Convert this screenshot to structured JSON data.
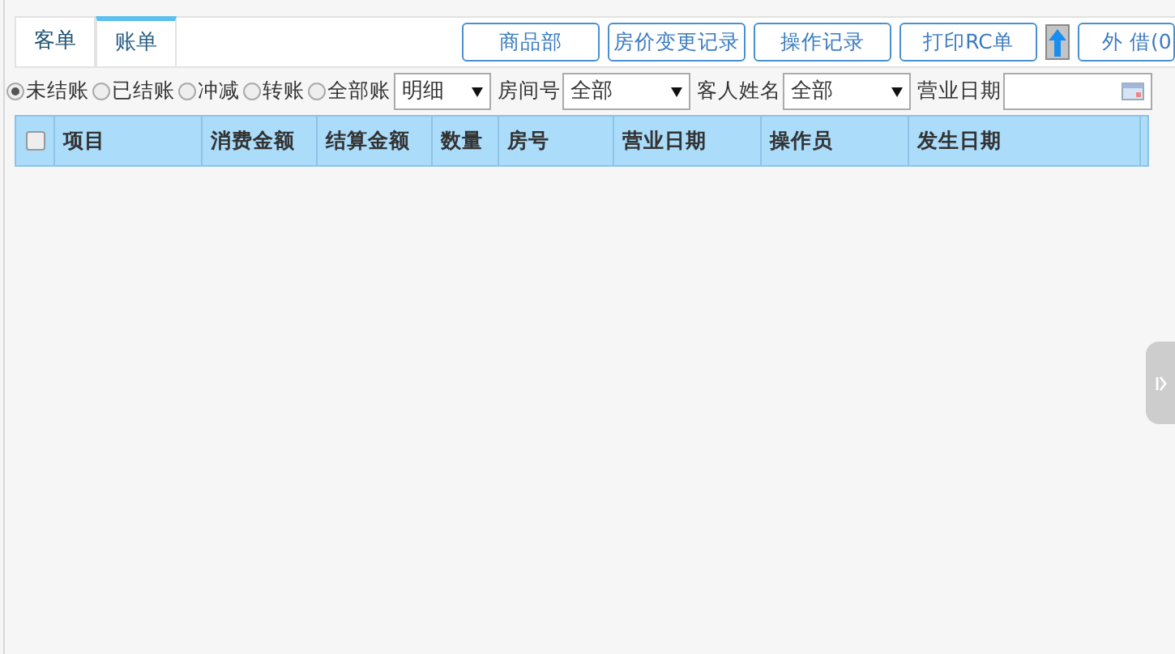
{
  "tabs": [
    {
      "label": "客单",
      "selected": false
    },
    {
      "label": "账单",
      "selected": true
    }
  ],
  "toolbar": [
    {
      "kind": "text",
      "label": "商品部"
    },
    {
      "kind": "text",
      "label": "房价变更记录"
    },
    {
      "kind": "text",
      "label": "操作记录"
    },
    {
      "kind": "text",
      "label": "打印RC单"
    },
    {
      "kind": "arrow"
    },
    {
      "kind": "text",
      "label": "外 借(0"
    }
  ],
  "status_filter": [
    {
      "label": "未结账",
      "selected": true
    },
    {
      "label": "已结账",
      "selected": false
    },
    {
      "label": "冲减",
      "selected": false
    },
    {
      "label": "转账",
      "selected": false
    },
    {
      "label": "全部账",
      "selected": false
    }
  ],
  "view_select": {
    "value": "明细"
  },
  "filters": [
    {
      "kind": "select",
      "label": "房间号",
      "value": "全部"
    },
    {
      "kind": "select",
      "label": "客人姓名",
      "value": "全部"
    },
    {
      "kind": "date",
      "label": "营业日期"
    }
  ],
  "table": {
    "select_all": {
      "checked": false
    },
    "columns": [
      "项目",
      "消费金额",
      "结算金额",
      "数量",
      "房号",
      "营业日期",
      "操作员",
      "发生日期"
    ]
  }
}
